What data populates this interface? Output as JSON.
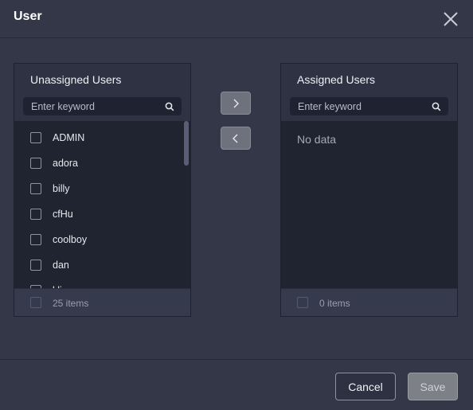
{
  "dialog": {
    "title": "User"
  },
  "left_panel": {
    "title": "Unassigned Users",
    "search_placeholder": "Enter keyword",
    "items": [
      {
        "label": "ADMIN"
      },
      {
        "label": "adora"
      },
      {
        "label": "billy"
      },
      {
        "label": "cfHu"
      },
      {
        "label": "coolboy"
      },
      {
        "label": "dan"
      },
      {
        "label": "kli"
      }
    ],
    "count": "25 items"
  },
  "right_panel": {
    "title": "Assigned Users",
    "search_placeholder": "Enter keyword",
    "empty_text": "No data",
    "count": "0 items"
  },
  "actions": {
    "cancel_label": "Cancel",
    "save_label": "Save"
  },
  "icons": {
    "close": "close-icon",
    "search": "search-icon",
    "move_right": "chevron-right-icon",
    "move_left": "chevron-left-icon"
  }
}
